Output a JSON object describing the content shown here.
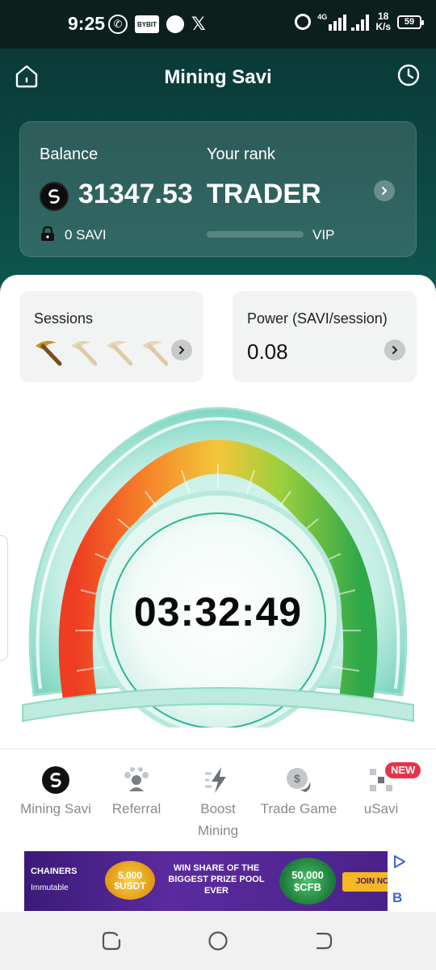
{
  "status_bar": {
    "time": "9:25",
    "bybit_label": "BYBIT",
    "network": "4G",
    "speed_value": "18",
    "speed_unit": "K/s",
    "battery": "59"
  },
  "header": {
    "title": "Mining Savi"
  },
  "balance_card": {
    "balance_label": "Balance",
    "rank_label": "Your rank",
    "balance_value": "31347.53",
    "rank_value": "TRADER",
    "locked_amount": "0 SAVI",
    "vip_label": "VIP",
    "vip_progress": 0.0
  },
  "sessions_card": {
    "label": "Sessions",
    "active_sessions": 1,
    "total_sessions": 4
  },
  "power_card": {
    "label": "Power (SAVI/session)",
    "value": "0.08"
  },
  "gauge": {
    "timer": "03:32:49"
  },
  "bottom_nav": {
    "items": [
      {
        "label": "Mining Savi",
        "icon": "savi-logo-icon",
        "active": true
      },
      {
        "label": "Referral",
        "icon": "referral-icon"
      },
      {
        "label": "Boost",
        "label2": "Mining",
        "icon": "lightning-icon"
      },
      {
        "label": "Trade Game",
        "icon": "coin-icon"
      },
      {
        "label": "uSavi",
        "icon": "network-icon",
        "badge": "NEW"
      }
    ]
  },
  "ad": {
    "brand_line1": "CHAINERS",
    "brand_line2": "Immutable",
    "badge1": "5,000 $USDT",
    "headline": "WIN SHARE OF THE BIGGEST PRIZE POOL EVER",
    "badge2": "50,000 $CFB",
    "cta": "JOIN NOW",
    "side_letter": "B"
  },
  "colors": {
    "header_bg": "#0a3a37",
    "accent": "#1f9e7f"
  }
}
